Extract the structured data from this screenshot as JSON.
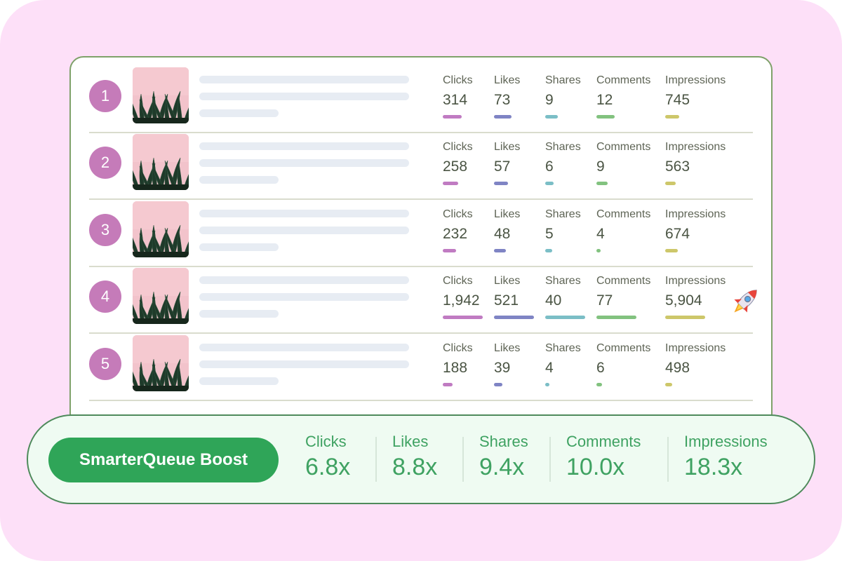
{
  "colors": {
    "background": "#fde0f8",
    "badge": "#c57bb9",
    "clicks": "#c07bc2",
    "likes": "#7f84c4",
    "shares": "#7bbec6",
    "comments": "#82c27f",
    "impressions": "#cdc76a",
    "boost_green": "#2fa558"
  },
  "metric_labels": {
    "clicks": "Clicks",
    "likes": "Likes",
    "shares": "Shares",
    "comments": "Comments",
    "impressions": "Impressions"
  },
  "posts": [
    {
      "rank": "1",
      "clicks": "314",
      "likes": "73",
      "shares": "9",
      "comments": "12",
      "impressions": "745",
      "bar_fraction": {
        "clicks": 0.47,
        "likes": 0.43,
        "shares": 0.32,
        "comments": 0.46,
        "impressions": 0.35
      }
    },
    {
      "rank": "2",
      "clicks": "258",
      "likes": "57",
      "shares": "6",
      "comments": "9",
      "impressions": "563",
      "bar_fraction": {
        "clicks": 0.39,
        "likes": 0.35,
        "shares": 0.21,
        "comments": 0.28,
        "impressions": 0.26
      }
    },
    {
      "rank": "3",
      "clicks": "232",
      "likes": "48",
      "shares": "5",
      "comments": "4",
      "impressions": "674",
      "bar_fraction": {
        "clicks": 0.33,
        "likes": 0.3,
        "shares": 0.18,
        "comments": 0.1,
        "impressions": 0.32
      }
    },
    {
      "rank": "4",
      "clicks": "1,942",
      "likes": "521",
      "shares": "40",
      "comments": "77",
      "impressions": "5,904",
      "bar_fraction": {
        "clicks": 1.0,
        "likes": 1.0,
        "shares": 1.0,
        "comments": 1.0,
        "impressions": 1.0
      },
      "icon": "rocket-icon"
    },
    {
      "rank": "5",
      "clicks": "188",
      "likes": "39",
      "shares": "4",
      "comments": "6",
      "impressions": "498",
      "bar_fraction": {
        "clicks": 0.25,
        "likes": 0.21,
        "shares": 0.1,
        "comments": 0.14,
        "impressions": 0.18
      }
    }
  ],
  "boost": {
    "label": "SmarterQueue Boost",
    "metrics": [
      {
        "key": "clicks",
        "label": "Clicks",
        "value": "6.8x"
      },
      {
        "key": "likes",
        "label": "Likes",
        "value": "8.8x"
      },
      {
        "key": "shares",
        "label": "Shares",
        "value": "9.4x"
      },
      {
        "key": "comments",
        "label": "Comments",
        "value": "10.0x"
      },
      {
        "key": "impressions",
        "label": "Impressions",
        "value": "18.3x"
      }
    ]
  }
}
